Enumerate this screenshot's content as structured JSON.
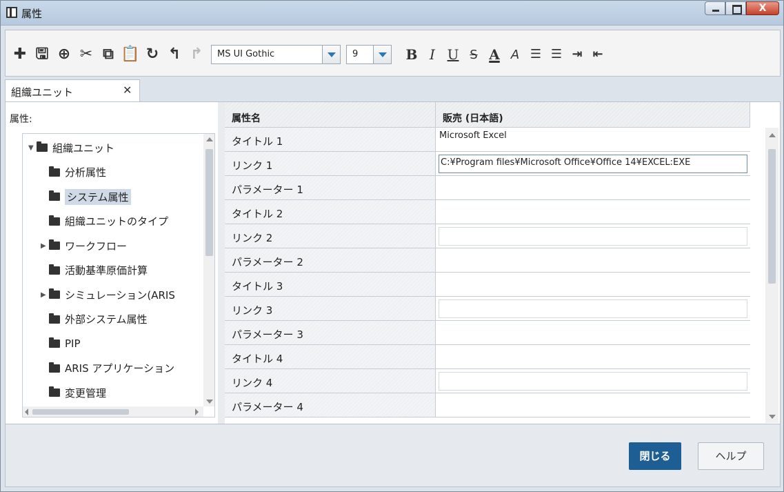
{
  "window": {
    "title": "属性",
    "close_glyph": "X"
  },
  "toolbar": {
    "icons": [
      {
        "name": "add-icon",
        "glyph": "✚",
        "disabled": false
      },
      {
        "name": "save-icon",
        "glyph": "🖫",
        "disabled": false
      },
      {
        "name": "insert-link-icon",
        "glyph": "⊕",
        "disabled": false
      },
      {
        "name": "cut-icon",
        "glyph": "✂",
        "disabled": false
      },
      {
        "name": "copy-icon",
        "glyph": "⧉",
        "disabled": false
      },
      {
        "name": "paste-icon",
        "glyph": "📋",
        "disabled": false
      },
      {
        "name": "refresh-icon",
        "glyph": "↻",
        "disabled": false
      },
      {
        "name": "undo-icon",
        "glyph": "↰",
        "disabled": false
      },
      {
        "name": "redo-icon",
        "glyph": "↱",
        "disabled": true
      }
    ],
    "font_name": "MS UI Gothic",
    "font_size": "9",
    "format": {
      "bold": "B",
      "italic": "I",
      "underline": "U",
      "strike": "S",
      "font_color": "A",
      "highlight": "A"
    },
    "list_icons": [
      "numbered-list-icon",
      "bullet-list-icon",
      "indent-icon",
      "outdent-icon"
    ]
  },
  "tabs": [
    {
      "label": "組織ユニット",
      "close": "✕"
    }
  ],
  "left_panel": {
    "label": "属性:",
    "tree": [
      {
        "label": "組織ユニット",
        "level": 0,
        "expanded": true,
        "arrow": "▼"
      },
      {
        "label": "分析属性",
        "level": 1,
        "arrow": ""
      },
      {
        "label": "システム属性",
        "level": 1,
        "selected": true,
        "arrow": ""
      },
      {
        "label": "組織ユニットのタイプ",
        "level": 1,
        "arrow": ""
      },
      {
        "label": "ワークフロー",
        "level": 1,
        "arrow": "▶"
      },
      {
        "label": "活動基準原価計算",
        "level": 1,
        "arrow": ""
      },
      {
        "label": "シミュレーション(ARIS",
        "level": 1,
        "arrow": "▶"
      },
      {
        "label": "外部システム属性",
        "level": 1,
        "arrow": ""
      },
      {
        "label": "PIP",
        "level": 1,
        "arrow": ""
      },
      {
        "label": "ARIS アプリケーション",
        "level": 1,
        "arrow": ""
      },
      {
        "label": "変更管理",
        "level": 1,
        "arrow": ""
      }
    ]
  },
  "grid": {
    "headers": [
      "属性名",
      "販売 (日本語)"
    ],
    "rows": [
      {
        "name": "タイトル 1",
        "value": "Microsoft Excel",
        "kind": "text"
      },
      {
        "name": "リンク 1",
        "value": "C:¥Program files¥Microsoft Office¥Office 14¥EXCEL:EXE",
        "kind": "active-input"
      },
      {
        "name": "パラメーター 1",
        "value": "",
        "kind": "text"
      },
      {
        "name": "タイトル 2",
        "value": "",
        "kind": "text"
      },
      {
        "name": "リンク 2",
        "value": "",
        "kind": "input"
      },
      {
        "name": "パラメーター 2",
        "value": "",
        "kind": "text"
      },
      {
        "name": "タイトル 3",
        "value": "",
        "kind": "text"
      },
      {
        "name": "リンク 3",
        "value": "",
        "kind": "input"
      },
      {
        "name": "パラメーター 3",
        "value": "",
        "kind": "text"
      },
      {
        "name": "タイトル 4",
        "value": "",
        "kind": "text"
      },
      {
        "name": "リンク 4",
        "value": "",
        "kind": "input"
      },
      {
        "name": "パラメーター 4",
        "value": "",
        "kind": "text"
      }
    ]
  },
  "footer": {
    "close_label": "閉じる",
    "help_label": "ヘルプ"
  },
  "colors": {
    "primary_button": "#1d5f95",
    "selection": "#cfdae6",
    "dropdown_arrow": "#2c78b7"
  }
}
